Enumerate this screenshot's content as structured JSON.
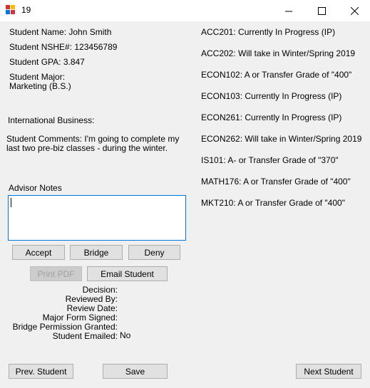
{
  "window": {
    "title": "19",
    "minimize_glyph": "—",
    "maximize_glyph": "☐",
    "close_glyph": "✕"
  },
  "student": {
    "name_line": "Student Name: John Smith",
    "nshe_line": "Student NSHE#: 123456789",
    "gpa_line": "Student GPA: 3.847",
    "major_label": "Student Major:",
    "major_value": "Marketing (B.S.)",
    "intl_business_line": "International Business:",
    "comments_line1": "Student Comments: I'm going to complete my",
    "comments_line2": "last two pre-biz classes -  during the winter."
  },
  "advisor": {
    "notes_label": "Advisor Notes",
    "notes_value": ""
  },
  "actions": {
    "accept": "Accept",
    "bridge": "Bridge",
    "deny": "Deny",
    "print_pdf": "Print PDF",
    "email_student": "Email Student"
  },
  "status": {
    "decision_label": "Decision:",
    "decision_value": "",
    "reviewed_by_label": "Reviewed By:",
    "reviewed_by_value": "",
    "review_date_label": "Review Date:",
    "review_date_value": "",
    "major_form_label": "Major Form Signed:",
    "major_form_value": "",
    "bridge_perm_label": "Bridge Permission Granted:",
    "bridge_perm_value": "",
    "emailed_label": "Student Emailed:",
    "emailed_value": "No"
  },
  "courses": [
    "ACC201: Currently In Progress (IP)",
    "ACC202: Will take in Winter/Spring 2019",
    "ECON102: A or Transfer Grade of \"400\"",
    "ECON103: Currently In Progress (IP)",
    "ECON261: Currently In Progress (IP)",
    "ECON262: Will take in Winter/Spring 2019",
    "IS101: A- or Transfer Grade of \"370\"",
    "MATH176: A or Transfer Grade of \"400\"",
    "MKT210: A or Transfer Grade of \"400\""
  ],
  "nav": {
    "prev": "Prev. Student",
    "save": "Save",
    "next": "Next Student"
  },
  "colors": {
    "focus_border": "#0078d7",
    "icon_red": "#d13438",
    "icon_yellow": "#ffb900",
    "icon_blue": "#0078d7"
  }
}
